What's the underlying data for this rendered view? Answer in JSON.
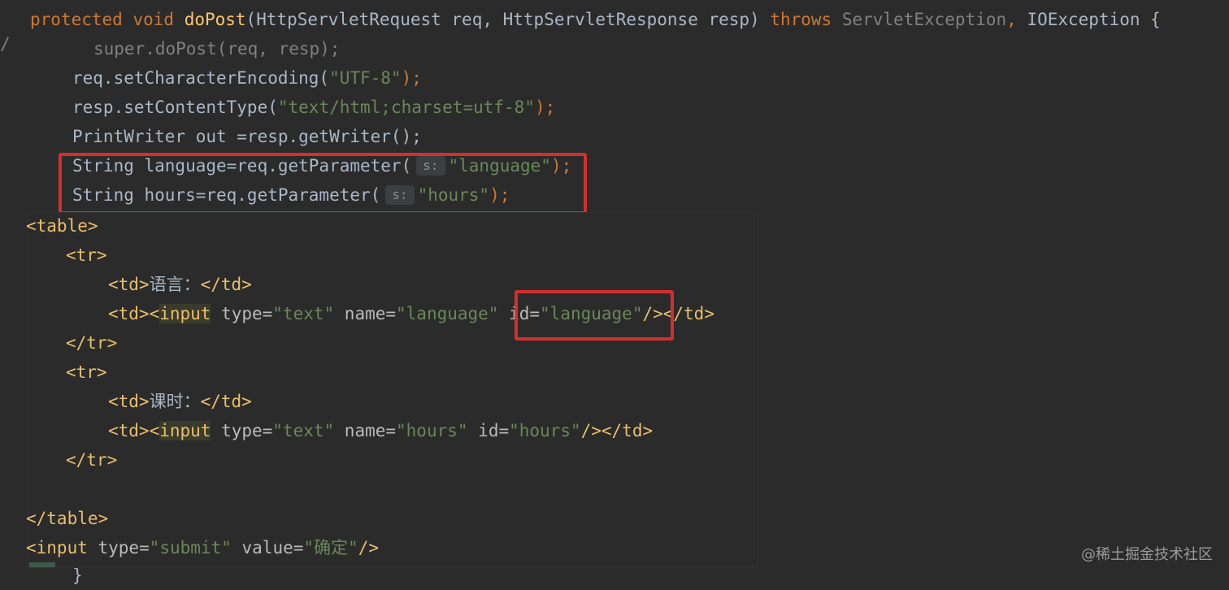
{
  "code": {
    "line1": {
      "kw1": "protected",
      "kw2": "void",
      "method": "doPost",
      "params": "(HttpServletRequest req, HttpServletResponse resp) ",
      "throws": "throws",
      "exc1": "ServletException",
      "comma": ", ",
      "exc2": "IOException {"
    },
    "line2": "super.doPost(req, resp);",
    "line3": {
      "pre": "req.setCharacterEncoding(",
      "str": "\"UTF-8\"",
      "post": ");"
    },
    "line4": {
      "pre": "resp.setContentType(",
      "str": "\"text/html;charset=utf-8\"",
      "post": ");"
    },
    "line5": "PrintWriter out =resp.getWriter();",
    "line6": {
      "pre": "String language=req.getParameter(",
      "hint": "s:",
      "str": "\"language\"",
      "post": ");"
    },
    "line7": {
      "pre": "String hours=req.getParameter(",
      "hint": "s:",
      "str": "\"hours\"",
      "post": ");"
    },
    "closing_brace": "}",
    "gutter_mark": "/"
  },
  "popup": {
    "l1": "<table>",
    "l2": "<tr>",
    "l3": {
      "open": "<td>",
      "text": "语言：",
      "close": "</td>"
    },
    "l4": {
      "td_open": "<td><",
      "input": "input",
      "type_attr": " type=",
      "type_val": "\"text\"",
      "name_attr": " name=",
      "name_val": "\"language\"",
      "id_attr": " id=",
      "id_val": "\"language\"",
      "end": "/></td>"
    },
    "l5": "</tr>",
    "l6": "<tr>",
    "l7": {
      "open": "<td>",
      "text": "课时：",
      "close": "</td>"
    },
    "l8": {
      "td_open": "<td><",
      "input": "input",
      "type_attr": " type=",
      "type_val": "\"text\"",
      "name_attr": " name=",
      "name_val": "\"hours\"",
      "id_attr": " id=",
      "id_val": "\"hours\"",
      "end": "/></td>"
    },
    "l9": "</tr>",
    "l10": "</table>",
    "l11": {
      "open": "<input",
      "type_attr": " type=",
      "type_val": "\"submit\"",
      "value_attr": " value=",
      "value_val": "\"确定\"",
      "end": "/>"
    }
  },
  "watermark": "@稀土掘金技术社区",
  "colors": {
    "background": "#2b2b2b",
    "keyword": "#cc7832",
    "method": "#ffc66d",
    "string": "#6a8759",
    "tag": "#e8bf6a",
    "highlight_box": "#d32f2f"
  }
}
